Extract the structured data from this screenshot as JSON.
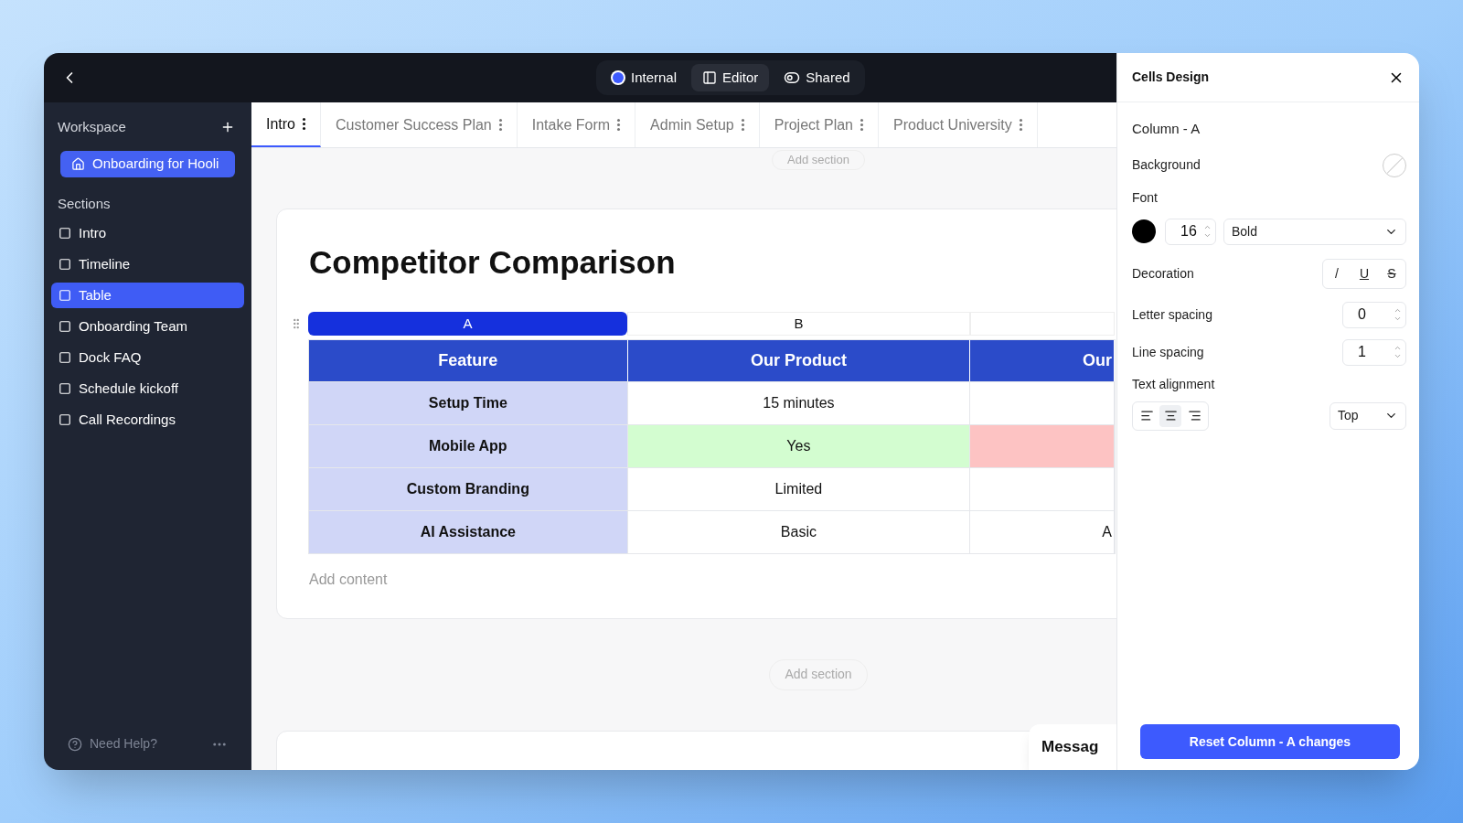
{
  "topbar": {
    "modes": [
      {
        "label": "Internal",
        "kind": "internal",
        "selected": false
      },
      {
        "label": "Editor",
        "kind": "editor",
        "selected": true
      },
      {
        "label": "Shared",
        "kind": "shared",
        "selected": false
      }
    ]
  },
  "sidebar": {
    "workspace_label": "Workspace",
    "workspace": "Onboarding for Hooli",
    "sections_label": "Sections",
    "items": [
      {
        "label": "Intro",
        "selected": false
      },
      {
        "label": "Timeline",
        "selected": false
      },
      {
        "label": "Table",
        "selected": true
      },
      {
        "label": "Onboarding Team",
        "selected": false
      },
      {
        "label": "Dock FAQ",
        "selected": false
      },
      {
        "label": "Schedule kickoff",
        "selected": false
      },
      {
        "label": "Call Recordings",
        "selected": false
      }
    ],
    "help": "Need Help?"
  },
  "tabs": [
    {
      "label": "Intro",
      "selected": true
    },
    {
      "label": "Customer Success Plan",
      "selected": false
    },
    {
      "label": "Intake Form",
      "selected": false
    },
    {
      "label": "Admin Setup",
      "selected": false
    },
    {
      "label": "Project Plan",
      "selected": false
    },
    {
      "label": "Product University",
      "selected": false
    }
  ],
  "content": {
    "add_section_top": "Add section",
    "title": "Competitor Comparison",
    "table": {
      "columns": [
        {
          "letter": "A",
          "selected": true
        },
        {
          "letter": "B",
          "selected": false
        }
      ],
      "header": [
        "Feature",
        "Our Product",
        "Our"
      ],
      "rows": [
        {
          "cells": [
            {
              "text": "Setup Time"
            },
            {
              "text": "15 minutes"
            },
            {}
          ]
        },
        {
          "cells": [
            {
              "text": "Mobile App"
            },
            {
              "text": "Yes",
              "color": "#d3fdd0"
            },
            {
              "color": "#fdc3c3"
            }
          ]
        },
        {
          "cells": [
            {
              "text": "Custom Branding"
            },
            {
              "text": "Limited"
            },
            {}
          ]
        },
        {
          "cells": [
            {
              "text": "AI Assistance"
            },
            {
              "text": "Basic"
            },
            {
              "text": "A"
            }
          ]
        }
      ]
    },
    "add_content": "Add content",
    "add_section_bottom": "Add section",
    "message_widget": "Messag"
  },
  "panel": {
    "title": "Cells Design",
    "target": "Column - A",
    "background_label": "Background",
    "font_label": "Font",
    "font_size": "16",
    "font_weight": "Bold",
    "decoration_label": "Decoration",
    "decorations": [
      {
        "label": "/",
        "kind": "italic",
        "on": false
      },
      {
        "label": "U",
        "kind": "underline",
        "on": false
      },
      {
        "label": "S",
        "kind": "strike",
        "on": false
      }
    ],
    "letter_spacing_label": "Letter spacing",
    "letter_spacing": "0",
    "line_spacing_label": "Line spacing",
    "line_spacing": "1",
    "alignment_label": "Text alignment",
    "alignments": [
      {
        "kind": "left",
        "selected": false
      },
      {
        "kind": "center",
        "selected": true
      },
      {
        "kind": "right",
        "selected": false
      }
    ],
    "vertical_align": "Top",
    "reset_button": "Reset Column - A changes"
  }
}
